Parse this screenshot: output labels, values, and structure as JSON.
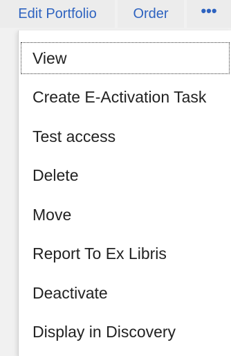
{
  "toolbar": {
    "edit_label": "Edit Portfolio",
    "order_label": "Order",
    "more_label": "•••"
  },
  "menu": {
    "items": [
      {
        "label": "View"
      },
      {
        "label": "Create E-Activation Task"
      },
      {
        "label": "Test access"
      },
      {
        "label": "Delete"
      },
      {
        "label": "Move"
      },
      {
        "label": "Report To Ex Libris"
      },
      {
        "label": "Deactivate"
      },
      {
        "label": "Display in Discovery"
      }
    ]
  },
  "colors": {
    "link": "#2e63c0",
    "menu_text": "#222222"
  }
}
